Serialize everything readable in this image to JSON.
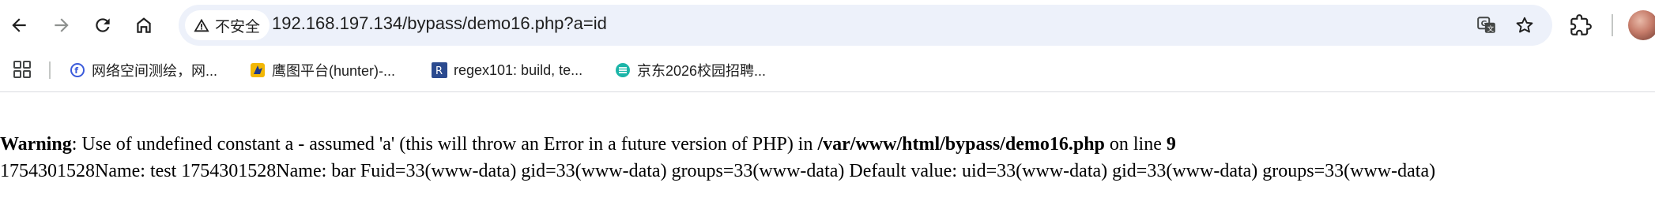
{
  "browser": {
    "security_label": "不安全",
    "url": "192.168.197.134/bypass/demo16.php?a=id",
    "bookmarks": [
      {
        "label": "网络空间测绘，网...",
        "favicon": "fofa-icon"
      },
      {
        "label": "鹰图平台(hunter)-...",
        "favicon": "hunter-icon"
      },
      {
        "label": "regex101: build, te...",
        "favicon": "regex101-icon"
      },
      {
        "label": "京东2026校园招聘...",
        "favicon": "jd-campus-icon"
      }
    ],
    "accent": "#1a73e8"
  },
  "page": {
    "warning": {
      "label": "Warning",
      "message": ": Use of undefined constant a - assumed 'a' (this will throw an Error in a future version of PHP) in ",
      "file": "/var/www/html/bypass/demo16.php",
      "on_line_text": " on line ",
      "line_number": "9"
    },
    "output": "1754301528Name: test 1754301528Name: bar Fuid=33(www-data) gid=33(www-data) groups=33(www-data) Default value: uid=33(www-data) gid=33(www-data) groups=33(www-data)"
  }
}
